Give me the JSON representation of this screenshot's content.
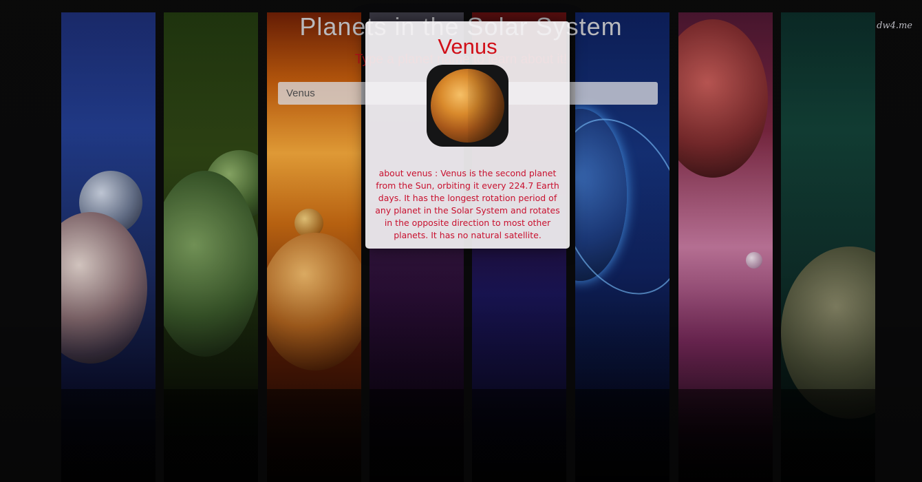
{
  "page": {
    "title": "Planets in the Solar System",
    "subtitle": "Type a planet name to learn about it!",
    "watermark": "dw4.me"
  },
  "search": {
    "value": "Venus",
    "placeholder": ""
  },
  "modal": {
    "title": "Venus",
    "image_icon": "venus-planet-image",
    "description": "about venus : Venus is the second planet from the Sun, orbiting it every 224.7 Earth days. It has the longest rotation period of any planet in the Solar System and rotates in the opposite direction to most other planets. It has no natural satellite."
  },
  "colors": {
    "accent_red": "#d10f18",
    "modal_bg": "#f4f2f4"
  }
}
